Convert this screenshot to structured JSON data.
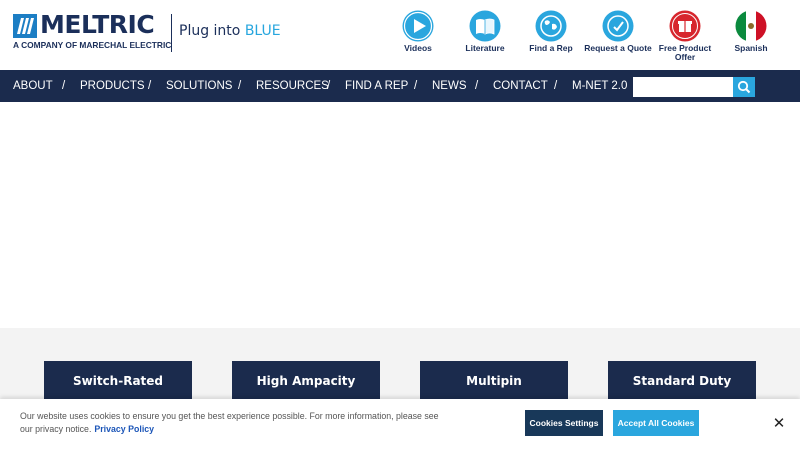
{
  "brand": {
    "name": "MELTRIC",
    "subline": "A COMPANY OF MARECHAL ELECTRIC",
    "tagline_prefix": "Plug into ",
    "tagline_accent": "BLUE",
    "colors": {
      "navy": "#1b2b4d",
      "accent": "#2aa6de"
    }
  },
  "utility": [
    {
      "icon": "play-icon",
      "label": "Videos"
    },
    {
      "icon": "book-icon",
      "label": "Literature"
    },
    {
      "icon": "globe-icon",
      "label": "Find a Rep"
    },
    {
      "icon": "quote-icon",
      "label": "Request a Quote"
    },
    {
      "icon": "free-offer-icon",
      "label": "Free Product Offer"
    },
    {
      "icon": "mexico-flag-icon",
      "label": "Spanish"
    }
  ],
  "nav": {
    "items": [
      "ABOUT",
      "PRODUCTS",
      "SOLUTIONS",
      "RESOURCES",
      "FIND A REP",
      "NEWS",
      "CONTACT",
      "M-NET 2.0"
    ],
    "separator": "/"
  },
  "search": {
    "placeholder": "",
    "icon": "search-icon"
  },
  "categories": [
    "Switch-Rated",
    "High Ampacity",
    "Multipin",
    "Standard Duty"
  ],
  "cookie": {
    "text": "Our website uses cookies to ensure you get the best experience possible. For more information, please see our privacy notice.",
    "policy_link": "Privacy Policy",
    "settings_label": "Cookies Settings",
    "accept_label": "Accept All Cookies",
    "close_label": "✕"
  }
}
